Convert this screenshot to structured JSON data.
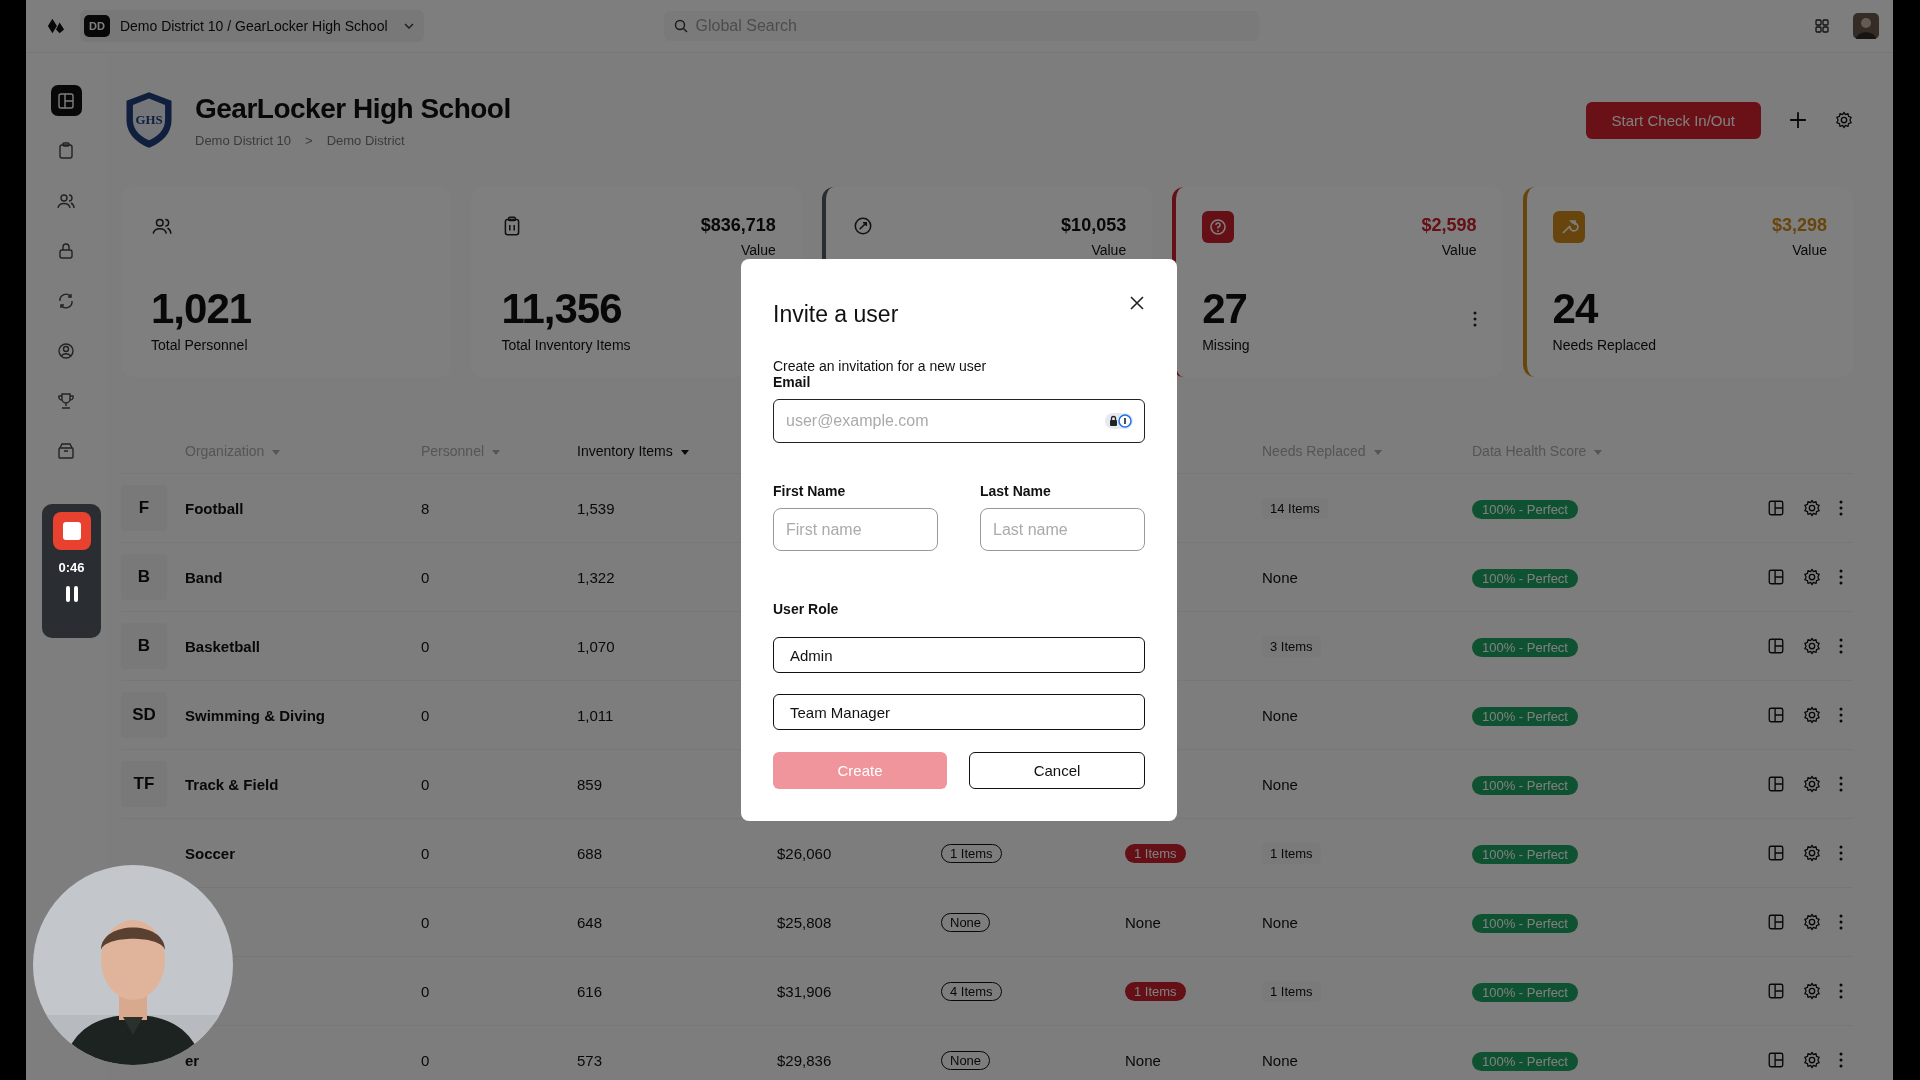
{
  "topbar": {
    "workspace_badge": "DD",
    "workspace": "Demo District 10 / GearLocker High School",
    "search": {
      "placeholder": "Global Search"
    }
  },
  "sidebar": {
    "items": [
      {
        "selected": true
      },
      {
        "selected": false
      },
      {
        "selected": false
      },
      {
        "selected": false
      },
      {
        "selected": false
      },
      {
        "selected": false
      },
      {
        "selected": false
      },
      {
        "selected": false
      }
    ]
  },
  "header": {
    "logo_text": "GHS",
    "title": "GearLocker High School",
    "breadcrumb": [
      "Demo District 10",
      ">",
      "Demo District"
    ],
    "primary_button": "Start Check In/Out"
  },
  "stats": [
    {
      "kind": "plain",
      "value": "1,021",
      "label": "Total Personnel"
    },
    {
      "kind": "plain",
      "amount": "$836,718",
      "amount_label": "Value",
      "value": "11,356",
      "label": "Total Inventory Items"
    },
    {
      "kind": "neutral",
      "amount": "$10,053",
      "amount_label": "Value"
    },
    {
      "kind": "danger",
      "amount": "$2,598",
      "amount_label": "Value",
      "value": "27",
      "label": "Missing",
      "menu": true
    },
    {
      "kind": "warning",
      "amount": "$3,298",
      "amount_label": "Value",
      "value": "24",
      "label": "Needs Replaced"
    }
  ],
  "table": {
    "columns": [
      {
        "label": "Organization",
        "active": false
      },
      {
        "label": "Personnel",
        "active": false
      },
      {
        "label": "Inventory Items",
        "active": true
      },
      {
        "label": "Needs Replaced",
        "active": false
      },
      {
        "label": "Data Health Score",
        "active": false
      }
    ],
    "rows": [
      {
        "initials": "F",
        "name": "Football",
        "personnel": "8",
        "inventory": "1,539",
        "needs_replaced": {
          "kind": "tag",
          "text": "14 Items"
        },
        "health": "100% - Perfect"
      },
      {
        "initials": "B",
        "name": "Band",
        "personnel": "0",
        "inventory": "1,322",
        "needs_replaced": {
          "kind": "plain",
          "text": "None"
        },
        "health": "100% - Perfect"
      },
      {
        "initials": "B",
        "name": "Basketball",
        "personnel": "0",
        "inventory": "1,070",
        "needs_replaced": {
          "kind": "tag",
          "text": "3 Items"
        },
        "health": "100% - Perfect"
      },
      {
        "initials": "SD",
        "name": "Swimming & Diving",
        "personnel": "0",
        "inventory": "1,011",
        "needs_replaced": {
          "kind": "plain",
          "text": "None"
        },
        "health": "100% - Perfect"
      },
      {
        "initials": "TF",
        "name": "Track & Field",
        "personnel": "0",
        "inventory": "859",
        "needs_replaced": {
          "kind": "plain",
          "text": "None"
        },
        "health": "100% - Perfect"
      },
      {
        "name": "Soccer",
        "personnel": "0",
        "inventory": "688",
        "value": "$26,060",
        "column_5": {
          "kind": "outline",
          "text": "1 Items"
        },
        "column_6": {
          "kind": "red",
          "text": "1 Items"
        },
        "needs_replaced": {
          "kind": "tag",
          "text": "1 Items"
        },
        "health": "100% - Perfect"
      },
      {
        "personnel": "0",
        "inventory": "648",
        "value": "$25,808",
        "column_5": {
          "kind": "outline",
          "text": "None"
        },
        "column_6": {
          "kind": "plain",
          "text": "None"
        },
        "needs_replaced": {
          "kind": "plain",
          "text": "None"
        },
        "health": "100% - Perfect"
      },
      {
        "personnel": "0",
        "inventory": "616",
        "value": "$31,906",
        "column_5": {
          "kind": "outline",
          "text": "4 Items"
        },
        "column_6": {
          "kind": "red",
          "text": "1 Items"
        },
        "needs_replaced": {
          "kind": "tag",
          "text": "1 Items"
        },
        "health": "100% - Perfect"
      },
      {
        "name": "er",
        "personnel": "0",
        "inventory": "573",
        "value": "$29,836",
        "column_5": {
          "kind": "outline",
          "text": "None"
        },
        "column_6": {
          "kind": "plain",
          "text": "None"
        },
        "needs_replaced": {
          "kind": "plain",
          "text": "None"
        },
        "health": "100% - Perfect"
      }
    ]
  },
  "dialog": {
    "title": "Invite a user",
    "description": "Create an invitation for a new user",
    "email": {
      "label": "Email",
      "placeholder": "user@example.com"
    },
    "first_name": {
      "label": "First Name",
      "placeholder": "First name"
    },
    "last_name": {
      "label": "Last Name",
      "placeholder": "Last name"
    },
    "role": {
      "label": "User Role",
      "options": [
        {
          "label": "Admin",
          "selected": false
        },
        {
          "label": "Team Manager",
          "selected": false
        }
      ]
    },
    "create": {
      "label": "Create",
      "disabled": true
    },
    "cancel": "Cancel"
  },
  "recorder": {
    "time": "0:46"
  }
}
